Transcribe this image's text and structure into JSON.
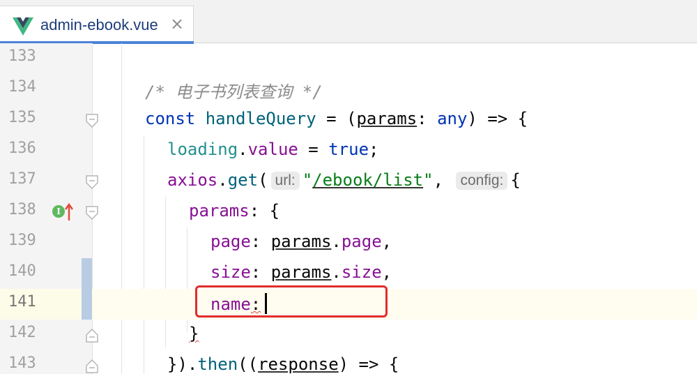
{
  "tab": {
    "icon": "vue-logo-icon",
    "title": "admin-ebook.vue",
    "close_icon": "close-icon"
  },
  "editor": {
    "current_line": "141",
    "lines": [
      {
        "number": "133"
      },
      {
        "number": "134",
        "comment": "/* 电子书列表查询 */"
      },
      {
        "number": "135",
        "kw": "const",
        "name": "handleQuery",
        "eq": " = (",
        "param": "params",
        "colon": ": ",
        "type": "any",
        "rest": ") => {"
      },
      {
        "number": "136",
        "obj": "loading",
        "dot": ".",
        "field": "value",
        "eq": " = ",
        "val": "true",
        "semi": ";"
      },
      {
        "number": "137",
        "obj": "axios",
        "dot": ".",
        "method": "get",
        "open": "(",
        "hint1": "url:",
        "str_open": "\"",
        "url": "/ebook/list",
        "str_close": "\"",
        "comma": ",",
        "hint2": "config:",
        "brace": "{"
      },
      {
        "number": "138",
        "key": "params",
        "rest": ": {"
      },
      {
        "number": "139",
        "key": "page",
        "colon": ": ",
        "obj": "params",
        "dot": ".",
        "field": "page",
        "comma": ","
      },
      {
        "number": "140",
        "key": "size",
        "colon": ": ",
        "obj": "params",
        "dot": ".",
        "field": "size",
        "comma": ","
      },
      {
        "number": "141",
        "key": "name",
        "colon": ":"
      },
      {
        "number": "142",
        "brace": "}"
      },
      {
        "number": "143",
        "close": "}).",
        "method": "then",
        "open": "((",
        "param": "response",
        "rest": ") => {"
      }
    ]
  },
  "markers": {
    "implements_icon": "implement-marker-icon",
    "arrow_icon": "up-arrow-icon"
  },
  "colors": {
    "keyword": "#0033b3",
    "property": "#871094",
    "string": "#067d17",
    "highlight": "#e12c2c"
  }
}
